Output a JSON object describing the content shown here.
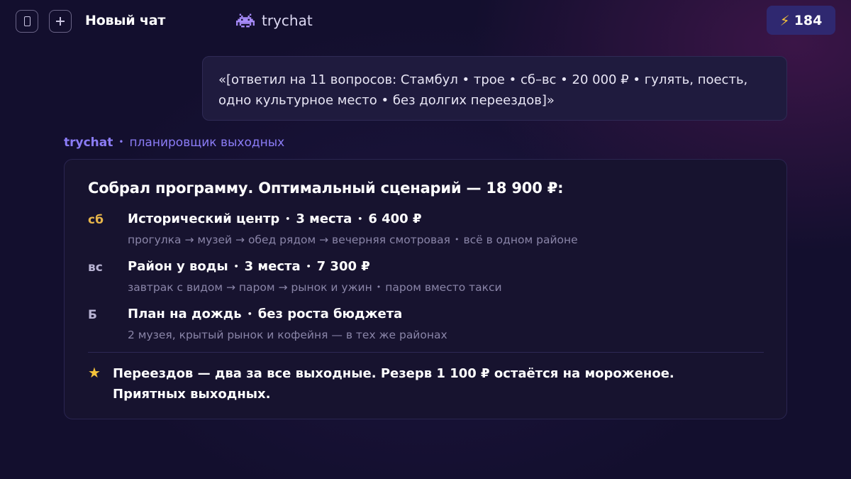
{
  "colors": {
    "background": "#130f2e",
    "accent": "#8b7cf6",
    "energy_bg": "#2f2870",
    "gold": "#e7b54a",
    "star": "#f5c33b"
  },
  "topbar": {
    "sidebar_icon": "sidebar-icon",
    "new_chat_icon": "plus-icon",
    "chat_title": "Новый чат",
    "brand_icon": "space-invader-icon",
    "brand_name": "trychat",
    "energy_icon": "lightning-icon",
    "energy_glyph": "⚡",
    "energy_count": "184"
  },
  "user_message": {
    "text": "«[ответил на 11 вопросов: Стамбул  •  трое  •  сб–вс  •  20 000 ₽  •  гулять, поесть, одно культурное место  •  без долгих переездов]»"
  },
  "bot": {
    "name": "trychat",
    "separator": "•",
    "role": "планировщик выходных"
  },
  "plan": {
    "title": "Собрал программу. Оптимальный сценарий — 18 900 ₽:",
    "separator": "•",
    "days": [
      {
        "tag": "сб",
        "name": "Исторический центр",
        "places": "3 места",
        "cost": "6 400 ₽",
        "route": "прогулка → музей → обед рядом → вечерняя смотровая",
        "note": "всё в одном районе"
      },
      {
        "tag": "вс",
        "name": "Район у воды",
        "places": "3 места",
        "cost": "7 300 ₽",
        "route": "завтрак с видом → паром → рынок и ужин",
        "note": "паром вместо такси"
      },
      {
        "tag": "Б",
        "name": "План на дождь",
        "places": "без роста бюджета",
        "route": "2 музея, крытый рынок и кофейня — в тех же районах"
      }
    ],
    "summary_icon": "star-icon",
    "summary_star": "★",
    "summary": "Переездов — два за все выходные. Резерв 1 100 ₽ остаётся на мороженое. Приятных выходных."
  }
}
